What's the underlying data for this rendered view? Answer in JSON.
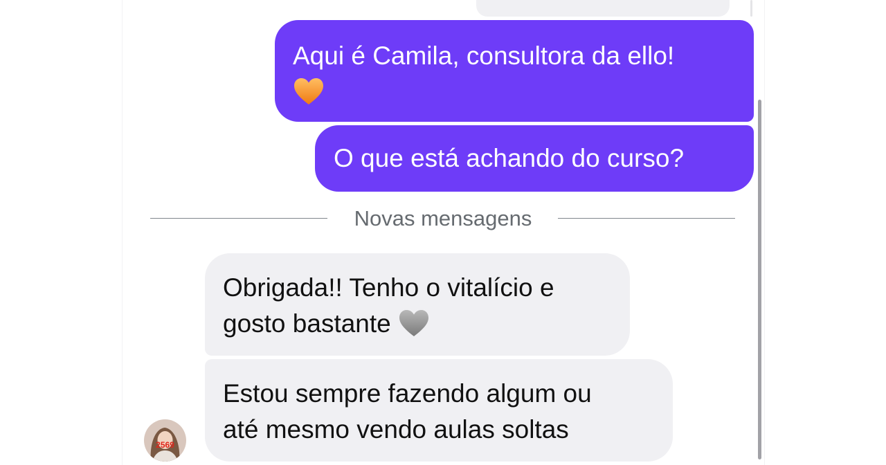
{
  "messages": [
    {
      "direction": "sent",
      "text": "Aqui é Camila, consultora da ello!",
      "emoji": "orange-heart"
    },
    {
      "direction": "sent",
      "text": "O que está achando do curso?"
    },
    {
      "direction": "received",
      "line1": "Obrigada!! Tenho o vitalício e",
      "line2": "gosto bastante",
      "emoji": "grey-heart"
    },
    {
      "direction": "received",
      "line1": "Estou sempre fazendo algum ou",
      "line2": "até mesmo vendo aulas soltas"
    }
  ],
  "divider": {
    "label": "Novas mensagens"
  },
  "contact": {
    "avatar_badge": "2569"
  },
  "colors": {
    "sent_bubble": "#6e3cf8",
    "received_bubble": "#f0f0f3",
    "divider_text": "#666b70",
    "badge": "#e0261b"
  }
}
